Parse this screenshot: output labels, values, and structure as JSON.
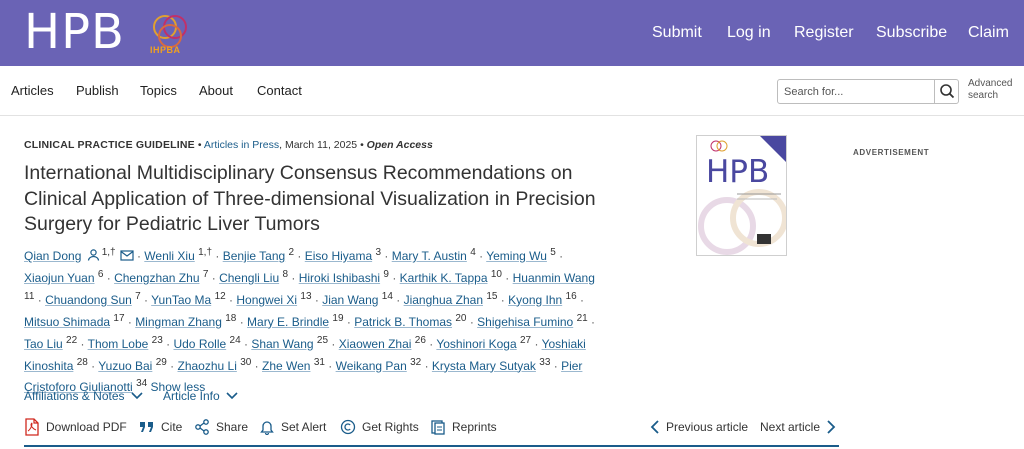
{
  "header": {
    "logo": "HPB",
    "emblem_label": "IHPBA",
    "nav": [
      "Submit",
      "Log in",
      "Register",
      "Subscribe",
      "Claim"
    ]
  },
  "subnav": {
    "items": [
      "Articles",
      "Publish",
      "Topics",
      "About",
      "Contact"
    ],
    "search_placeholder": "Search for...",
    "advanced_search": [
      "Advanced",
      "search"
    ]
  },
  "article": {
    "type": "CLINICAL PRACTICE GUIDELINE",
    "status": "Articles in Press",
    "date": "March 11, 2025",
    "access": "Open Access",
    "title": "International Multidisciplinary Consensus Recommendations on Clinical Application of Three-dimensional Visualization in Precision Surgery for Pediatric Liver Tumors",
    "authors": [
      {
        "name": "Qian Dong",
        "sup": "1,†"
      },
      {
        "name": "Wenli Xiu",
        "sup": "1,†"
      },
      {
        "name": "Benjie Tang",
        "sup": "2"
      },
      {
        "name": "Eiso Hiyama",
        "sup": "3"
      },
      {
        "name": "Mary T. Austin",
        "sup": "4"
      },
      {
        "name": "Yeming Wu",
        "sup": "5"
      },
      {
        "name": "Xiaojun Yuan",
        "sup": "6"
      },
      {
        "name": "Chengzhan Zhu",
        "sup": "7"
      },
      {
        "name": "Chengli Liu",
        "sup": "8"
      },
      {
        "name": "Hiroki Ishibashi",
        "sup": "9"
      },
      {
        "name": "Karthik K. Tappa",
        "sup": "10"
      },
      {
        "name": "Huanmin Wang",
        "sup": "11"
      },
      {
        "name": "Chuandong Sun",
        "sup": "7"
      },
      {
        "name": "YunTao Ma",
        "sup": "12"
      },
      {
        "name": "Hongwei Xi",
        "sup": "13"
      },
      {
        "name": "Jian Wang",
        "sup": "14"
      },
      {
        "name": "Jianghua Zhan",
        "sup": "15"
      },
      {
        "name": "Kyong Ihn",
        "sup": "16"
      },
      {
        "name": "Mitsuo Shimada",
        "sup": "17"
      },
      {
        "name": "Mingman Zhang",
        "sup": "18"
      },
      {
        "name": "Mary E. Brindle",
        "sup": "19"
      },
      {
        "name": "Patrick B. Thomas",
        "sup": "20"
      },
      {
        "name": "Shigehisa Fumino",
        "sup": "21"
      },
      {
        "name": "Tao Liu",
        "sup": "22"
      },
      {
        "name": "Thom Lobe",
        "sup": "23"
      },
      {
        "name": "Udo Rolle",
        "sup": "24"
      },
      {
        "name": "Shan Wang",
        "sup": "25"
      },
      {
        "name": "Xiaowen Zhai",
        "sup": "26"
      },
      {
        "name": "Yoshinori Koga",
        "sup": "27"
      },
      {
        "name": "Yoshiaki Kinoshita",
        "sup": "28"
      },
      {
        "name": "Yuzuo Bai",
        "sup": "29"
      },
      {
        "name": "Zhaozhu Li",
        "sup": "30"
      },
      {
        "name": "Zhe Wen",
        "sup": "31"
      },
      {
        "name": "Weikang Pan",
        "sup": "32"
      },
      {
        "name": "Krysta Mary Sutyak",
        "sup": "33"
      },
      {
        "name": "Pier Cristoforo Giulianotti",
        "sup": "34"
      }
    ],
    "show_less": "Show less",
    "affiliations": "Affiliations & Notes",
    "article_info": "Article Info"
  },
  "actions": {
    "download_pdf": "Download PDF",
    "cite": "Cite",
    "share": "Share",
    "set_alert": "Set Alert",
    "get_rights": "Get Rights",
    "reprints": "Reprints",
    "previous": "Previous article",
    "next": "Next article"
  },
  "sidebar": {
    "cover_title": "HPB",
    "advertisement": "ADVERTISEMENT"
  },
  "colors": {
    "header_bg": "#6a63b5",
    "link": "#1a5c8a",
    "pdf_red": "#d0281e"
  }
}
